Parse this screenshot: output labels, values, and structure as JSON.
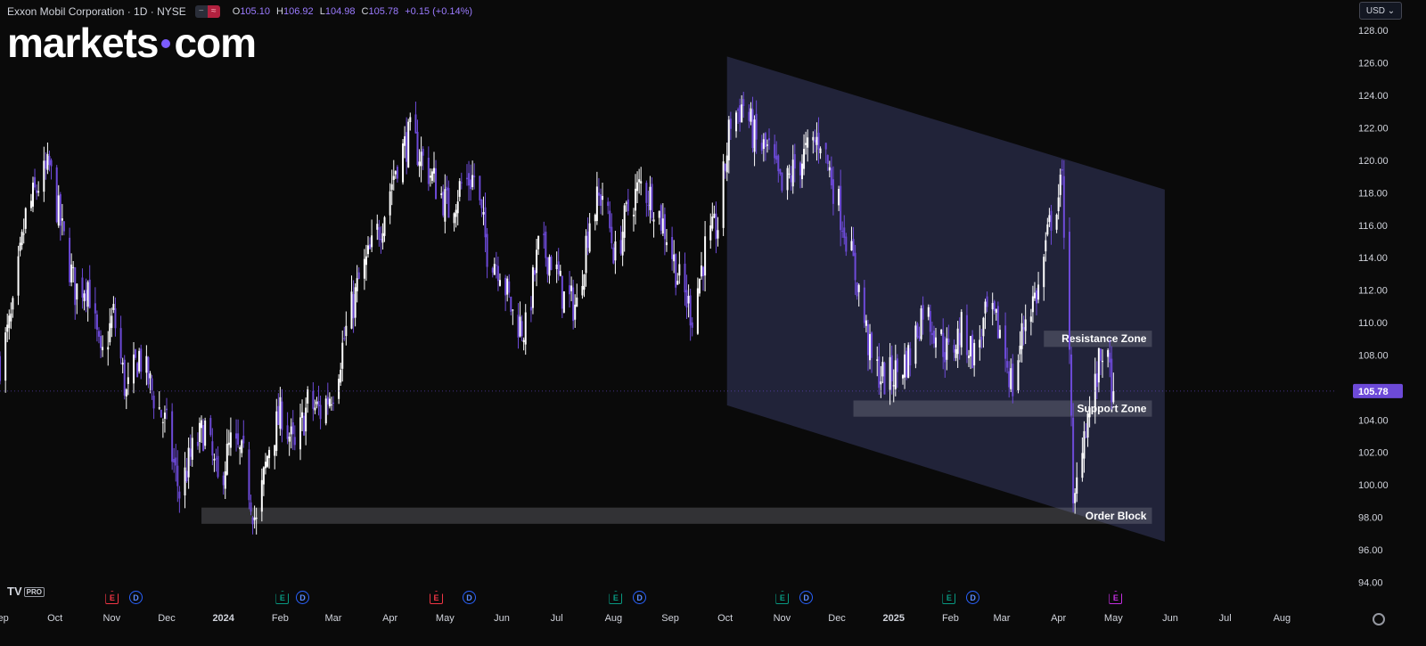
{
  "header": {
    "symbol": "Exxon Mobil Corporation · 1D · NYSE",
    "o_label": "O",
    "o": "105.10",
    "h_label": "H",
    "h": "106.92",
    "l_label": "L",
    "l": "104.98",
    "c_label": "C",
    "c": "105.78",
    "change": "+0.15 (+0.14%)"
  },
  "brand": {
    "text_left": "markets",
    "text_right": "com"
  },
  "currency": "USD ⌄",
  "tv": {
    "name": "TV",
    "badge": "PRO"
  },
  "events": [
    {
      "kind": "earnings",
      "label": "E",
      "date": "2023-11-01",
      "color": "#f23645"
    },
    {
      "kind": "dividend",
      "label": "D",
      "date": "2023-11-14"
    },
    {
      "kind": "earnings",
      "label": "E",
      "date": "2024-02-02",
      "color": "#089981"
    },
    {
      "kind": "dividend",
      "label": "D",
      "date": "2024-02-13"
    },
    {
      "kind": "earnings",
      "label": "E",
      "date": "2024-04-26",
      "color": "#f23645"
    },
    {
      "kind": "dividend",
      "label": "D",
      "date": "2024-05-14"
    },
    {
      "kind": "earnings",
      "label": "E",
      "date": "2024-08-02",
      "color": "#089981"
    },
    {
      "kind": "dividend",
      "label": "D",
      "date": "2024-08-15"
    },
    {
      "kind": "earnings",
      "label": "E",
      "date": "2024-11-01",
      "color": "#089981"
    },
    {
      "kind": "dividend",
      "label": "D",
      "date": "2024-11-14"
    },
    {
      "kind": "earnings",
      "label": "E",
      "date": "2025-01-31",
      "color": "#089981"
    },
    {
      "kind": "dividend",
      "label": "D",
      "date": "2025-02-13"
    },
    {
      "kind": "earnings",
      "label": "E",
      "date": "2025-05-02",
      "color": "#c32ee0"
    }
  ],
  "chart_data": {
    "type": "candlestick",
    "title": "Exxon Mobil Corporation · 1D · NYSE",
    "y_axis": {
      "range": [
        93.2,
        129.0
      ],
      "ticks": [
        "94.00",
        "96.00",
        "98.00",
        "100.00",
        "102.00",
        "104.00",
        "106.00",
        "108.00",
        "110.00",
        "112.00",
        "114.00",
        "116.00",
        "118.00",
        "120.00",
        "122.00",
        "124.00",
        "126.00",
        "128.00"
      ]
    },
    "x_axis": {
      "range": [
        "2023-09-01",
        "2025-08-31"
      ],
      "ticks": [
        {
          "label": "Sep",
          "date": "2023-09-01"
        },
        {
          "label": "Oct",
          "date": "2023-10-01"
        },
        {
          "label": "Nov",
          "date": "2023-11-01"
        },
        {
          "label": "Dec",
          "date": "2023-12-01"
        },
        {
          "label": "2024",
          "date": "2024-01-01"
        },
        {
          "label": "Feb",
          "date": "2024-02-01"
        },
        {
          "label": "Mar",
          "date": "2024-03-01"
        },
        {
          "label": "Apr",
          "date": "2024-04-01"
        },
        {
          "label": "May",
          "date": "2024-05-01"
        },
        {
          "label": "Jun",
          "date": "2024-06-01"
        },
        {
          "label": "Jul",
          "date": "2024-07-01"
        },
        {
          "label": "Aug",
          "date": "2024-08-01"
        },
        {
          "label": "Sep",
          "date": "2024-09-01"
        },
        {
          "label": "Oct",
          "date": "2024-10-01"
        },
        {
          "label": "Nov",
          "date": "2024-11-01"
        },
        {
          "label": "Dec",
          "date": "2024-12-01"
        },
        {
          "label": "2025",
          "date": "2025-01-01"
        },
        {
          "label": "Feb",
          "date": "2025-02-01"
        },
        {
          "label": "Mar",
          "date": "2025-03-01"
        },
        {
          "label": "Apr",
          "date": "2025-04-01"
        },
        {
          "label": "May",
          "date": "2025-05-01"
        },
        {
          "label": "Jun",
          "date": "2025-06-01"
        },
        {
          "label": "Jul",
          "date": "2025-07-01"
        },
        {
          "label": "Aug",
          "date": "2025-08-01"
        }
      ]
    },
    "up_color": "#ffffff",
    "down_color": "#6d4ad8",
    "last_price": {
      "value": 105.78,
      "label": "105.78",
      "color": "#6d4ad8"
    },
    "anchor_close": [
      [
        "2023-09-01",
        107.6
      ],
      [
        "2023-09-08",
        110.5
      ],
      [
        "2023-09-15",
        116.5
      ],
      [
        "2023-09-22",
        118.5
      ],
      [
        "2023-09-28",
        119.5
      ],
      [
        "2023-10-05",
        115.5
      ],
      [
        "2023-10-12",
        112.0
      ],
      [
        "2023-10-19",
        112.5
      ],
      [
        "2023-10-26",
        107.5
      ],
      [
        "2023-11-02",
        110.5
      ],
      [
        "2023-11-09",
        105.5
      ],
      [
        "2023-11-16",
        108.0
      ],
      [
        "2023-11-24",
        105.5
      ],
      [
        "2023-12-01",
        103.5
      ],
      [
        "2023-12-08",
        99.5
      ],
      [
        "2023-12-15",
        102.0
      ],
      [
        "2023-12-22",
        103.5
      ],
      [
        "2023-12-29",
        100.0
      ],
      [
        "2024-01-05",
        102.5
      ],
      [
        "2024-01-12",
        101.5
      ],
      [
        "2024-01-19",
        97.5
      ],
      [
        "2024-01-26",
        102.5
      ],
      [
        "2024-02-02",
        104.5
      ],
      [
        "2024-02-09",
        102.0
      ],
      [
        "2024-02-16",
        105.0
      ],
      [
        "2024-02-23",
        104.5
      ],
      [
        "2024-03-01",
        106.0
      ],
      [
        "2024-03-08",
        109.5
      ],
      [
        "2024-03-15",
        112.5
      ],
      [
        "2024-03-22",
        114.5
      ],
      [
        "2024-03-28",
        116.5
      ],
      [
        "2024-04-05",
        120.0
      ],
      [
        "2024-04-12",
        121.5
      ],
      [
        "2024-04-19",
        120.0
      ],
      [
        "2024-04-26",
        118.5
      ],
      [
        "2024-05-03",
        117.0
      ],
      [
        "2024-05-10",
        118.5
      ],
      [
        "2024-05-17",
        119.0
      ],
      [
        "2024-05-24",
        114.5
      ],
      [
        "2024-05-31",
        113.5
      ],
      [
        "2024-06-07",
        110.5
      ],
      [
        "2024-06-14",
        109.5
      ],
      [
        "2024-06-21",
        114.5
      ],
      [
        "2024-06-28",
        114.0
      ],
      [
        "2024-07-05",
        111.5
      ],
      [
        "2024-07-12",
        111.0
      ],
      [
        "2024-07-19",
        116.5
      ],
      [
        "2024-07-26",
        118.0
      ],
      [
        "2024-08-02",
        114.0
      ],
      [
        "2024-08-09",
        117.0
      ],
      [
        "2024-08-16",
        118.5
      ],
      [
        "2024-08-23",
        117.5
      ],
      [
        "2024-08-30",
        115.5
      ],
      [
        "2024-09-06",
        112.5
      ],
      [
        "2024-09-13",
        110.5
      ],
      [
        "2024-09-20",
        114.5
      ],
      [
        "2024-09-27",
        116.0
      ],
      [
        "2024-10-04",
        122.5
      ],
      [
        "2024-10-11",
        123.5
      ],
      [
        "2024-10-18",
        121.0
      ],
      [
        "2024-10-25",
        120.5
      ],
      [
        "2024-11-01",
        118.0
      ],
      [
        "2024-11-08",
        119.5
      ],
      [
        "2024-11-15",
        120.5
      ],
      [
        "2024-11-22",
        121.5
      ],
      [
        "2024-11-29",
        118.5
      ],
      [
        "2024-12-06",
        115.5
      ],
      [
        "2024-12-13",
        112.0
      ],
      [
        "2024-12-20",
        107.5
      ],
      [
        "2024-12-27",
        106.5
      ],
      [
        "2025-01-03",
        107.0
      ],
      [
        "2025-01-10",
        108.0
      ],
      [
        "2025-01-17",
        111.0
      ],
      [
        "2025-01-24",
        109.5
      ],
      [
        "2025-01-31",
        108.0
      ],
      [
        "2025-02-07",
        109.5
      ],
      [
        "2025-02-14",
        108.0
      ],
      [
        "2025-02-21",
        110.5
      ],
      [
        "2025-02-28",
        109.5
      ],
      [
        "2025-03-07",
        106.0
      ],
      [
        "2025-03-14",
        110.5
      ],
      [
        "2025-03-21",
        112.0
      ],
      [
        "2025-03-28",
        116.5
      ],
      [
        "2025-04-03",
        118.5
      ],
      [
        "2025-04-07",
        109.0
      ],
      [
        "2025-04-09",
        98.0
      ],
      [
        "2025-04-14",
        103.0
      ],
      [
        "2025-04-21",
        106.0
      ],
      [
        "2025-04-25",
        108.5
      ],
      [
        "2025-05-01",
        105.78
      ]
    ],
    "annotations": [
      {
        "kind": "channel",
        "upper": [
          [
            "2024-10-02",
            126.4
          ],
          [
            "2025-05-29",
            118.2
          ]
        ],
        "lower": [
          [
            "2024-10-02",
            104.9
          ],
          [
            "2025-05-29",
            96.5
          ]
        ]
      },
      {
        "kind": "zone",
        "label": "Resistance Zone",
        "x": [
          "2025-03-24",
          "2025-05-22"
        ],
        "y": [
          108.5,
          109.5
        ]
      },
      {
        "kind": "zone",
        "label": "Support Zone",
        "x": [
          "2024-12-10",
          "2025-05-22"
        ],
        "y": [
          104.2,
          105.2
        ]
      },
      {
        "kind": "zone",
        "label": "Order Block",
        "x": [
          "2023-12-20",
          "2025-05-22"
        ],
        "y": [
          97.6,
          98.6
        ]
      }
    ]
  }
}
